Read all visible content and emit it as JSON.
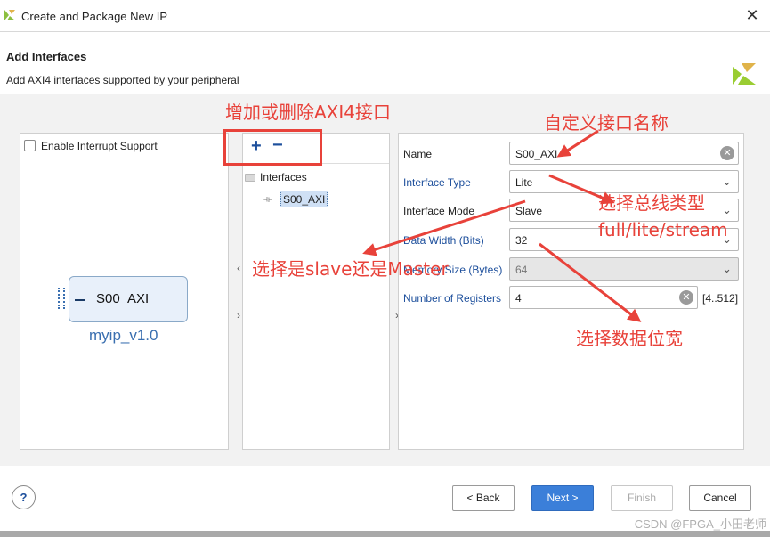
{
  "window": {
    "title": "Create and Package New IP"
  },
  "header": {
    "title": "Add Interfaces",
    "subtitle": "Add AXI4 interfaces supported by your peripheral"
  },
  "left_panel": {
    "interrupt_label": "Enable Interrupt Support",
    "interrupt_checked": false,
    "block_name": "S00_AXI",
    "ip_name": "myip_v1.0"
  },
  "tree": {
    "root_label": "Interfaces",
    "items": [
      "S00_AXI"
    ]
  },
  "form": {
    "name_label": "Name",
    "name_value": "S00_AXI",
    "interface_type_label": "Interface Type",
    "interface_type_value": "Lite",
    "interface_mode_label": "Interface Mode",
    "interface_mode_value": "Slave",
    "data_width_label": "Data Width (Bits)",
    "data_width_value": "32",
    "memory_size_label": "Memory Size (Bytes)",
    "memory_size_value": "64",
    "num_registers_label": "Number of Registers",
    "num_registers_value": "4",
    "num_registers_range": "[4..512]"
  },
  "footer": {
    "help": "?",
    "back_label": "< Back",
    "next_label": "Next >",
    "finish_label": "Finish",
    "cancel_label": "Cancel",
    "watermark": "CSDN @FPGA_小田老师"
  },
  "annotations": {
    "add_remove": "增加或删除AXI4接口",
    "custom_name": "自定义接口名称",
    "bus_type_line1": "选择总线类型",
    "bus_type_line2": "full/lite/stream",
    "slave_master": "选择是slave还是Master",
    "data_width": "选择数据位宽"
  },
  "colors": {
    "accent_blue": "#1d4f9c",
    "primary_button": "#3b7fd9",
    "annotation_red": "#e8423a"
  }
}
